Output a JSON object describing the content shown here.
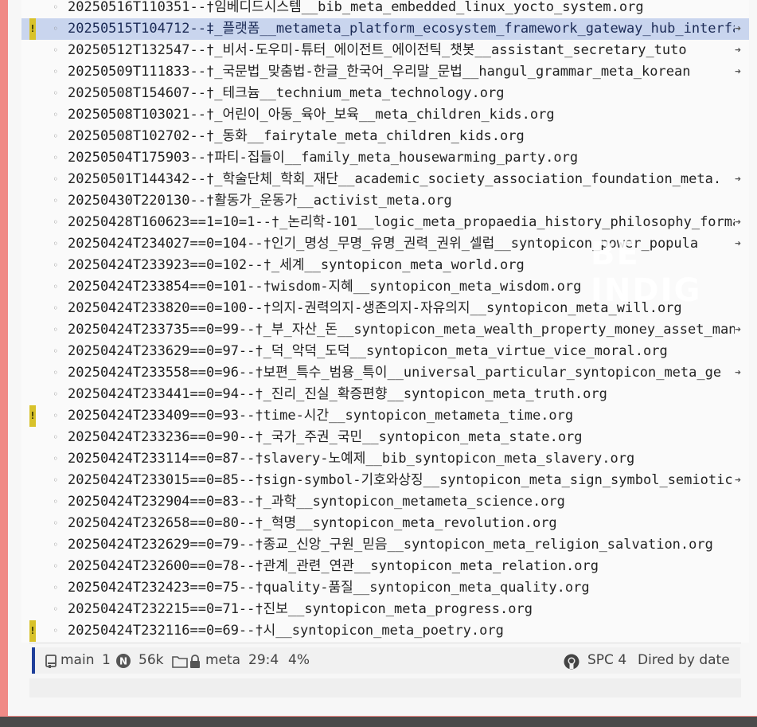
{
  "files": [
    {
      "name": "20250516T110351--†임베디드시스템__bib_meta_embedded_linux_yocto_system.org",
      "truncated": false,
      "selected": false,
      "warning": false
    },
    {
      "name": "20250515T104712--‡_플랫폼__metameta_platform_ecosystem_framework_gateway_hub_interfa",
      "truncated": true,
      "selected": true,
      "warning": true
    },
    {
      "name": "20250512T132547--†_비서-도우미-튜터_에이전트_에이전틱_챗봇__assistant_secretary_tuto",
      "truncated": true,
      "selected": false,
      "warning": false
    },
    {
      "name": "20250509T111833--†_국문법_맞춤법-한글_한국어_우리말_문법__hangul_grammar_meta_korean",
      "truncated": true,
      "selected": false,
      "warning": false
    },
    {
      "name": "20250508T154607--†_테크늄__technium_meta_technology.org",
      "truncated": false,
      "selected": false,
      "warning": false
    },
    {
      "name": "20250508T103021--†_어린이_아동_육아_보육__meta_children_kids.org",
      "truncated": false,
      "selected": false,
      "warning": false
    },
    {
      "name": "20250508T102702--†_동화__fairytale_meta_children_kids.org",
      "truncated": false,
      "selected": false,
      "warning": false
    },
    {
      "name": "20250504T175903--†파티-집들이__family_meta_housewarming_party.org",
      "truncated": false,
      "selected": false,
      "warning": false
    },
    {
      "name": "20250501T144342--†_학술단체_학회_재단__academic_society_association_foundation_meta.",
      "truncated": true,
      "selected": false,
      "warning": false
    },
    {
      "name": "20250430T220130--†활동가_운동가__activist_meta.org",
      "truncated": false,
      "selected": false,
      "warning": false
    },
    {
      "name": "20250428T160623==1=10=1--†_논리학-101__logic_meta_propaedia_history_philosophy_forma",
      "truncated": true,
      "selected": false,
      "warning": false
    },
    {
      "name": "20250424T234027==0=104--†인기_명성_무명_유명_권력_권위_셀럽__syntopicon_power_popula",
      "truncated": true,
      "selected": false,
      "warning": false
    },
    {
      "name": "20250424T233923==0=102--†_세계__syntopicon_meta_world.org",
      "truncated": false,
      "selected": false,
      "warning": false
    },
    {
      "name": "20250424T233854==0=101--†wisdom-지혜__syntopicon_meta_wisdom.org",
      "truncated": false,
      "selected": false,
      "warning": false
    },
    {
      "name": "20250424T233820==0=100--†의지-권력의지-생존의지-자유의지__syntopicon_meta_will.org",
      "truncated": false,
      "selected": false,
      "warning": false
    },
    {
      "name": "20250424T233735==0=99--†_부_자산_돈__syntopicon_meta_wealth_property_money_asset_man",
      "truncated": true,
      "selected": false,
      "warning": false
    },
    {
      "name": "20250424T233629==0=97--†_덕_악덕_도덕__syntopicon_meta_virtue_vice_moral.org",
      "truncated": false,
      "selected": false,
      "warning": false
    },
    {
      "name": "20250424T233558==0=96--†보편_특수_범용_특이__universal_particular_syntopicon_meta_ge",
      "truncated": true,
      "selected": false,
      "warning": false
    },
    {
      "name": "20250424T233441==0=94--†_진리_진실_확증편향__syntopicon_meta_truth.org",
      "truncated": false,
      "selected": false,
      "warning": false
    },
    {
      "name": "20250424T233409==0=93--†time-시간__syntopicon_metameta_time.org",
      "truncated": false,
      "selected": false,
      "warning": true
    },
    {
      "name": "20250424T233236==0=90--†_국가_주권_국민__syntopicon_meta_state.org",
      "truncated": false,
      "selected": false,
      "warning": false
    },
    {
      "name": "20250424T233114==0=87--†slavery-노예제__bib_syntopicon_meta_slavery.org",
      "truncated": false,
      "selected": false,
      "warning": false
    },
    {
      "name": "20250424T233015==0=85--†sign-symbol-기호와상징__syntopicon_meta_sign_symbol_semiotic",
      "truncated": true,
      "selected": false,
      "warning": false
    },
    {
      "name": "20250424T232904==0=83--†_과학__syntopicon_metameta_science.org",
      "truncated": false,
      "selected": false,
      "warning": false
    },
    {
      "name": "20250424T232658==0=80--†_혁명__syntopicon_meta_revolution.org",
      "truncated": false,
      "selected": false,
      "warning": false
    },
    {
      "name": "20250424T232629==0=79--†종교_신앙_구원_믿음__syntopicon_meta_religion_salvation.org",
      "truncated": false,
      "selected": false,
      "warning": false
    },
    {
      "name": "20250424T232600==0=78--†관계_관련_연관__syntopicon_meta_relation.org",
      "truncated": false,
      "selected": false,
      "warning": false
    },
    {
      "name": "20250424T232423==0=75--†quality-품질__syntopicon_meta_quality.org",
      "truncated": false,
      "selected": false,
      "warning": false
    },
    {
      "name": "20250424T232215==0=71--†진보__syntopicon_meta_progress.org",
      "truncated": false,
      "selected": false,
      "warning": false
    },
    {
      "name": "20250424T232116==0=69--†시__syntopicon_meta_poetry.org",
      "truncated": false,
      "selected": false,
      "warning": true
    }
  ],
  "bullet_glyph": "◦",
  "more_glyph": "➜",
  "warning_glyph": "!",
  "watermark": "BE INDIG",
  "modeline": {
    "branch": "main",
    "count": "1",
    "size": "56k",
    "directory": "meta",
    "position": "29:4",
    "percent": "4%",
    "editor": "SPC 4",
    "mode": "Dired by date"
  },
  "colors": {
    "frame": "#f08a86",
    "selection": "#c9d5ee",
    "warning": "#d8c22a",
    "modeline_accent": "#1f3f9a"
  }
}
